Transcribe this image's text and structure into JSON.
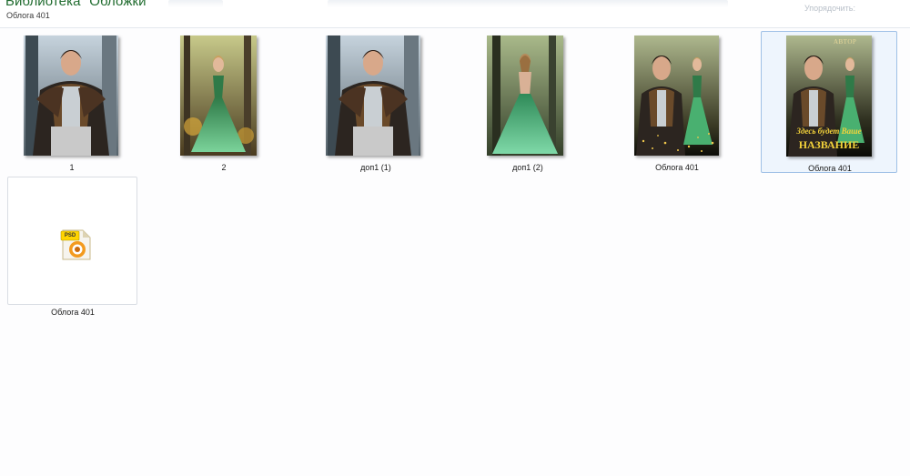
{
  "header": {
    "title": "Библиотека \"Обложки\"",
    "subtitle": "Облога 401",
    "arrange_label": "Упорядочить:"
  },
  "files": [
    {
      "name": "1",
      "kind": "image-man"
    },
    {
      "name": "2",
      "kind": "image-woman-front"
    },
    {
      "name": "доп1 (1)",
      "kind": "image-man"
    },
    {
      "name": "доп1 (2)",
      "kind": "image-woman-back"
    },
    {
      "name": "Облога  401",
      "kind": "image-couple"
    },
    {
      "name": "Облога 401",
      "kind": "image-cover",
      "selected": true
    },
    {
      "name": "Облога 401",
      "kind": "psd"
    }
  ],
  "cover": {
    "author": "АВТОР",
    "title_line1": "Здесь будет Ваше",
    "title_line2": "НАЗВАНИЕ"
  },
  "psd_badge": "PSD",
  "colors": {
    "title_green": "#1f6b2e",
    "selection_border": "#9fc0e6",
    "selection_fill": "#eef5fd",
    "dress_green": "#3fa86b",
    "cover_gold": "#f3d23a"
  }
}
